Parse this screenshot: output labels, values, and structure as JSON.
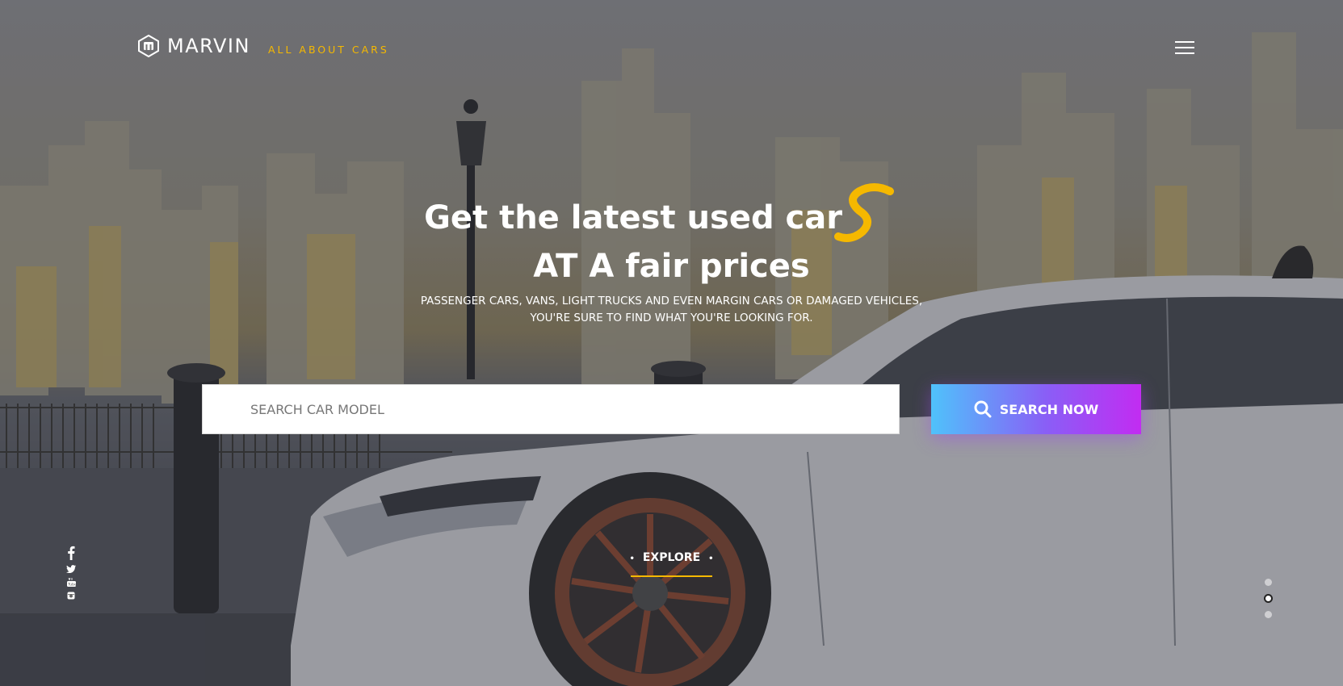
{
  "brand": {
    "name": "MARVIN",
    "tagline": "ALL ABOUT CARS"
  },
  "hero": {
    "headline_line1": "Get the latest used car",
    "headline_line2": "AT A fair prices",
    "subtext_line1": "PASSENGER CARS, VANS, LIGHT TRUCKS AND EVEN MARGIN CARS OR DAMAGED VEHICLES,",
    "subtext_line2": "YOU'RE SURE TO FIND WHAT YOU'RE LOOKING FOR."
  },
  "search": {
    "placeholder": "SEARCH CAR MODEL",
    "value": "",
    "button_label": "SEARCH NOW"
  },
  "explore": {
    "label": "EXPLORE"
  },
  "social": [
    "facebook-icon",
    "twitter-icon",
    "youtube-icon",
    "instagram-icon"
  ],
  "pager": {
    "count": 3,
    "active_index": 1
  },
  "colors": {
    "accent_yellow": "#f5b800",
    "button_gradient_start": "#4fc2fb",
    "button_gradient_end": "#c22cf2"
  }
}
